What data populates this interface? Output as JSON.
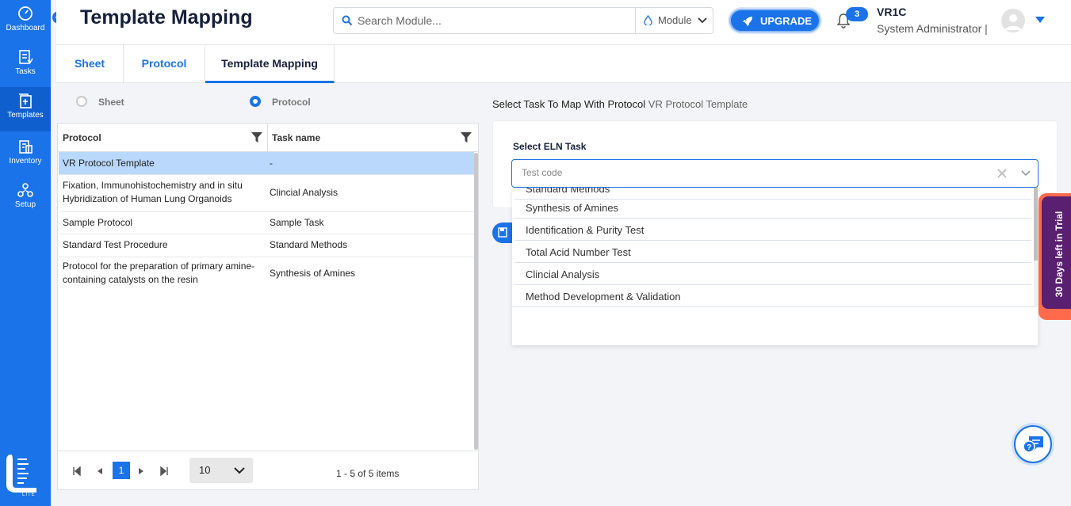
{
  "sidebar": {
    "items": [
      {
        "label": "Dashboard",
        "icon": "dashboard-icon"
      },
      {
        "label": "Tasks",
        "icon": "tasks-icon"
      },
      {
        "label": "Templates",
        "icon": "templates-icon"
      },
      {
        "label": "Inventory",
        "icon": "inventory-icon"
      },
      {
        "label": "Setup",
        "icon": "setup-icon"
      }
    ],
    "active_item": "Templates",
    "logo_subtext": "LITE"
  },
  "header": {
    "title": "Template Mapping",
    "search_placeholder": "Search Module...",
    "module_label": "Module",
    "upgrade_label": "UPGRADE",
    "notification_count": "3",
    "user_name": "VR1C",
    "user_role": "System Administrator |"
  },
  "tabs": [
    {
      "label": "Sheet",
      "active": false
    },
    {
      "label": "Protocol",
      "active": false
    },
    {
      "label": "Template Mapping",
      "active": true
    }
  ],
  "mode_radios": [
    {
      "label": "Sheet",
      "checked": false
    },
    {
      "label": "Protocol",
      "checked": true
    }
  ],
  "grid": {
    "columns": [
      "Protocol",
      "Task name"
    ],
    "rows": [
      {
        "protocol": "VR Protocol Template",
        "task": "-",
        "selected": true
      },
      {
        "protocol": "Fixation, Immunohistochemistry and in situ Hybridization of Human Lung Organoids",
        "task": "Clincial Analysis",
        "selected": false
      },
      {
        "protocol": "Sample Protocol",
        "task": "Sample Task",
        "selected": false
      },
      {
        "protocol": "Standard Test Procedure",
        "task": "Standard Methods",
        "selected": false
      },
      {
        "protocol": "Protocol for the preparation of primary amine-containing catalysts on the resin",
        "task": "Synthesis of Amines",
        "selected": false
      }
    ],
    "pager": {
      "current_page": "1",
      "page_size": "10",
      "info": "1 - 5 of 5 items"
    }
  },
  "mapping": {
    "heading": "Select Task To Map With Protocol",
    "protocol_name": "VR Protocol Template",
    "field_label": "Select ELN Task",
    "placeholder": "Test code",
    "options": [
      "Standard Methods",
      "Synthesis of Amines",
      "Identification & Purity Test",
      "Total Acid Number Test",
      "Clincial Analysis",
      "Method Development & Validation"
    ]
  },
  "trial_banner": "30 Days left in Trial",
  "colors": {
    "primary": "#1a73e8",
    "selected_row": "#b9d8fb",
    "trial_bg": "#5a1f70",
    "trial_accent": "#ff6a4d"
  }
}
